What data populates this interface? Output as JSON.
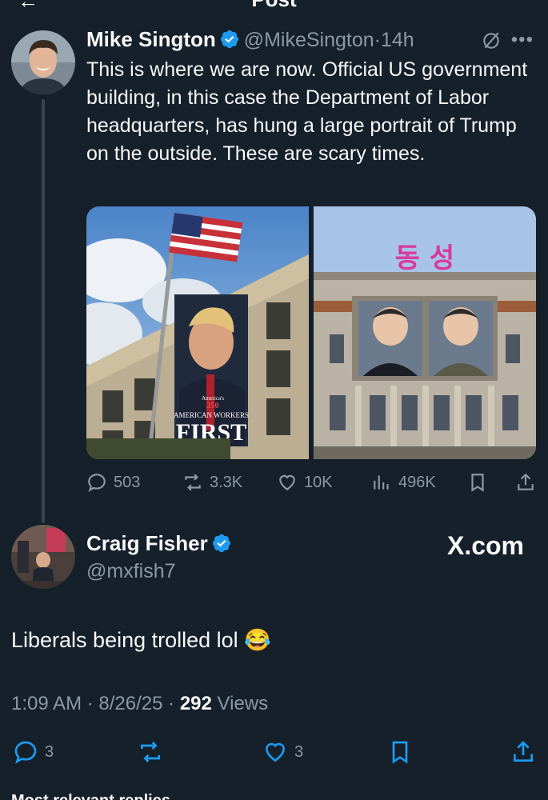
{
  "header": {
    "title": "Post"
  },
  "parent_tweet": {
    "name": "Mike Sington",
    "handle": "@MikeSington",
    "separator": "·",
    "time": "14h",
    "text": "This is where we are now. Official US government building, in this case the Department of Labor headquarters, has hung a large portrait of Trump on the outside. These are scary times.",
    "image_left_banner": {
      "line1": "America's",
      "line2": "250",
      "line3": "AMERICAN WORKERS",
      "line4": "FIRST"
    },
    "image_right_sign": "동 성",
    "stats": {
      "replies": "503",
      "reposts": "3.3K",
      "likes": "10K",
      "views": "496K"
    }
  },
  "main_tweet": {
    "name": "Craig Fisher",
    "handle": "@mxfish7",
    "source_logo": "X.com",
    "text": "Liberals being trolled lol",
    "emoji": "😂",
    "time": "1:09 AM",
    "date": "8/26/25",
    "views_count": "292",
    "views_label": "Views",
    "separator": "·",
    "stats": {
      "replies": "3",
      "reposts": "",
      "likes": "3"
    }
  },
  "footer_cut": "Most relevant replies",
  "colors": {
    "bg": "#15202b",
    "text": "#f7f9f9",
    "muted": "#8b98a5",
    "verified": "#1d9bf0"
  }
}
